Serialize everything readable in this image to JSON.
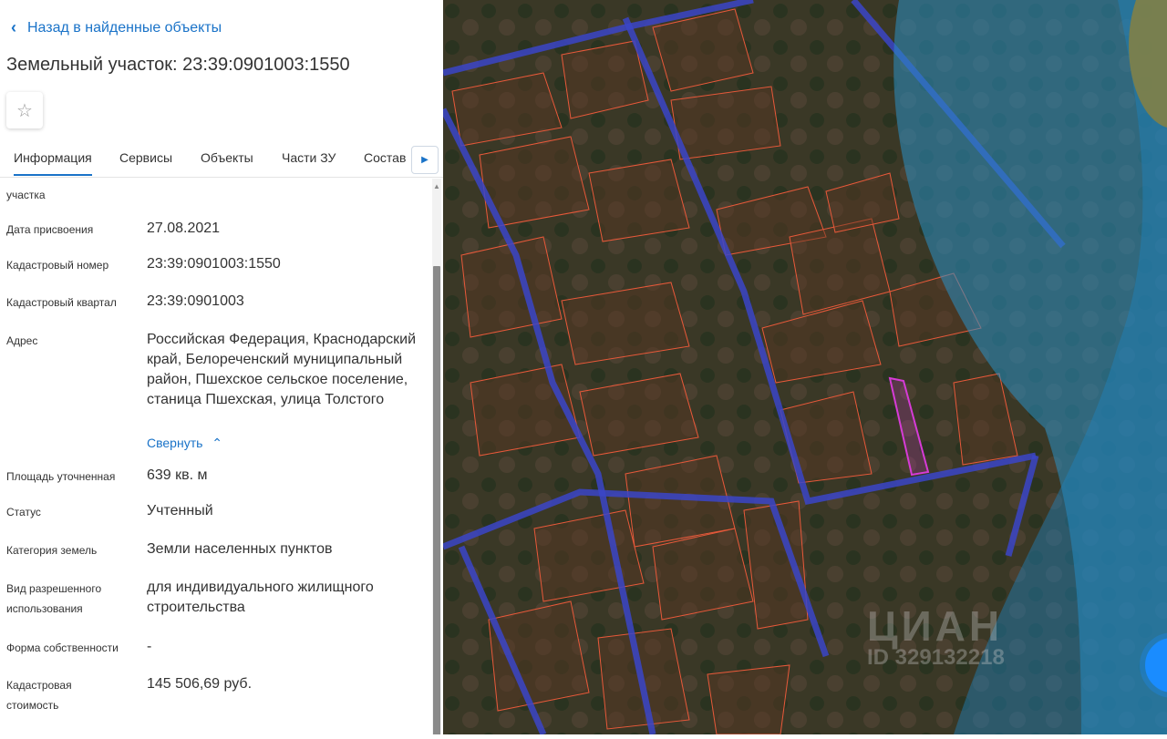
{
  "header": {
    "back_label": "Назад в найденные объекты",
    "title": "Земельный участок: 23:39:0901003:1550"
  },
  "tabs": [
    {
      "label": "Информация",
      "active": true
    },
    {
      "label": "Сервисы"
    },
    {
      "label": "Объекты"
    },
    {
      "label": "Части ЗУ"
    },
    {
      "label": "Состав"
    }
  ],
  "fields": {
    "partial_label": "участка",
    "date_label": "Дата присвоения",
    "date": "27.08.2021",
    "cad_num_label": "Кадастровый номер",
    "cad_num": "23:39:0901003:1550",
    "quarter_label": "Кадастровый квартал",
    "quarter": "23:39:0901003",
    "address_label": "Адрес",
    "address": "Российская Федерация, Краснодарский край, Белореченский муниципальный район, Пшехское сельское поселение, станица Пшехская, улица Толстого",
    "collapse_label": "Свернуть",
    "area_label": "Площадь уточненная",
    "area": "639 кв. м",
    "status_label": "Статус",
    "status": "Учтенный",
    "category_label": "Категория земель",
    "category": "Земли населенных пунктов",
    "use_label_1": "Вид разрешенного",
    "use_label_2": "использования",
    "use": "для индивидуального жилищного строительства",
    "ownership_label": "Форма собственности",
    "ownership": "-",
    "cost_label_1": "Кадастровая",
    "cost_label_2": "стоимость",
    "cost": "145 506,69 руб."
  },
  "map": {
    "watermark": "ЦИАН",
    "watermark_id": "ID 329132218",
    "colors": {
      "parcel": "#e8593a",
      "road": "#3b45c8",
      "selected": "#d63bd6",
      "water": "#2a8fc4"
    }
  }
}
